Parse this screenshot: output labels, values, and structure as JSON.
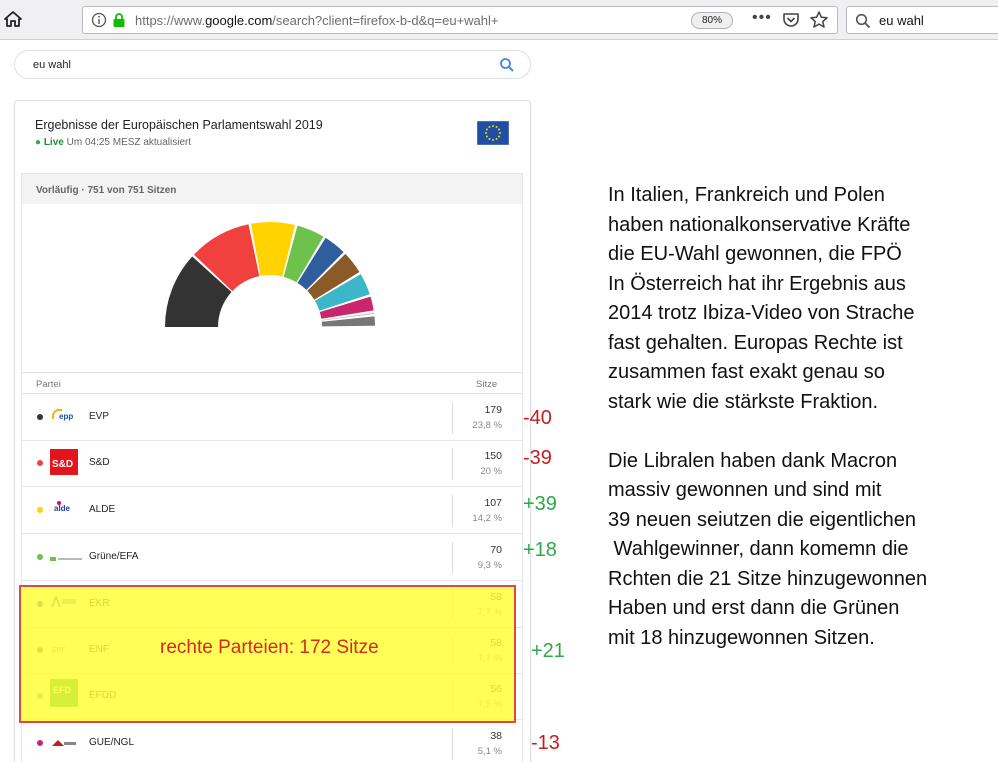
{
  "browser": {
    "url_prefix": "https://www.",
    "url_domain": "google.com",
    "url_rest": "/search?client=firefox-b-d&q=eu+wahl+",
    "zoom": "80%",
    "more": "•••",
    "search_value": "eu wahl"
  },
  "google": {
    "query": "eu wahl"
  },
  "card": {
    "title": "Ergebnisse der Europäischen Parlamentswahl 2019",
    "live_dot": "●",
    "live": "Live",
    "updated": "Um 04:25 MESZ aktualisiert",
    "caption": "Vorläufig · 751 von 751 Sitzen",
    "col_party": "Partei",
    "col_seats": "Sitze",
    "parties": [
      {
        "name": "EVP",
        "seats": "179",
        "pct": "23,8 %",
        "seats_value": 179,
        "color": "#333333",
        "logo": "epp"
      },
      {
        "name": "S&D",
        "seats": "150",
        "pct": "20 %",
        "seats_value": 150,
        "color": "#f0413f",
        "logo": "sd"
      },
      {
        "name": "ALDE",
        "seats": "107",
        "pct": "14,2 %",
        "seats_value": 107,
        "color": "#ffd200",
        "logo": "alde"
      },
      {
        "name": "Grüne/EFA",
        "seats": "70",
        "pct": "9,3 %",
        "seats_value": 70,
        "color": "#6cc24a",
        "logo": "greens"
      },
      {
        "name": "EKR",
        "seats": "58",
        "pct": "7,7 %",
        "seats_value": 58,
        "color": "#2f5e9f",
        "logo": "ecr"
      },
      {
        "name": "ENF",
        "seats": "58",
        "pct": "7,7 %",
        "seats_value": 58,
        "color": "#8a5a28",
        "logo": "enf"
      },
      {
        "name": "EFDD",
        "seats": "56",
        "pct": "7,5 %",
        "seats_value": 56,
        "color": "#3eb6c9",
        "logo": "efdd"
      },
      {
        "name": "GUE/NGL",
        "seats": "38",
        "pct": "5,1 %",
        "seats_value": 38,
        "color": "#c8286b",
        "logo": "gue"
      }
    ],
    "rest_segments": [
      {
        "seats_value": 8,
        "color": "#bbbbbb"
      },
      {
        "seats_value": 27,
        "color": "#777777"
      }
    ]
  },
  "overlay": {
    "label": "rechte Parteien: 172 Sitze"
  },
  "deltas": [
    "-40",
    "-39",
    "+39",
    "+18",
    "+21",
    "-13"
  ],
  "commentary": {
    "p1": [
      "In Italien, Frankreich und Polen",
      "haben nationalkonservative Kräfte",
      "die EU-Wahl gewonnen, die FPÖ",
      "In Österreich hat ihr Ergebnis aus",
      "2014 trotz Ibiza-Video von Strache",
      "fast gehalten. Europas Rechte ist",
      "zusammen fast exakt genau so",
      "stark wie die stärkste Fraktion."
    ],
    "p2": [
      "Die Libralen haben dank Macron",
      "massiv gewonnen und sind mit",
      "39 neuen seiutzen die eigentlichen",
      " Wahlgewinner, dann komemn die",
      "Rchten die 21 Sitze hinzugewonnen",
      "Haben und erst dann die Grünen",
      "mit 18 hinzugewonnen Sitzen."
    ]
  },
  "colors": {
    "highlight": "#ffff33",
    "highlight_border": "#d62020",
    "negative": "#c41e1e",
    "positive": "#2ea84a"
  }
}
